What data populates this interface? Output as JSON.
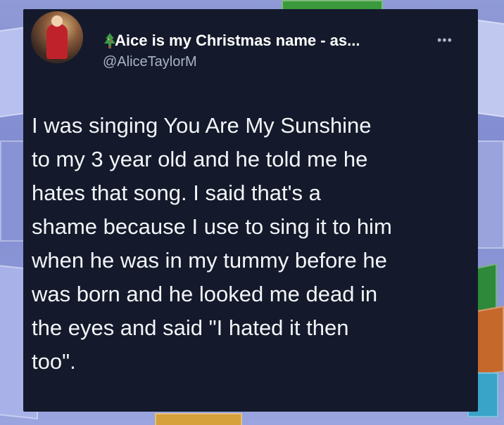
{
  "tweet": {
    "display_name": "Aice is my Christmas name - as...",
    "handle": "@AliceTaylorM",
    "name_emoji": "christmas-tree-icon",
    "more_icon": "more-options-icon",
    "text": "I was singing You Are My Sunshine\nto my 3 year old and he told me he\nhates that song. I said that's a\nshame because I use to sing it to him\nwhen he was in my tummy before he\nwas born and he looked me dead in\nthe eyes and said \"I hated it then\ntoo\"."
  },
  "colors": {
    "card_background": "#141a2b",
    "text_primary": "#f2f4f8",
    "text_secondary": "#a9b3c4"
  }
}
